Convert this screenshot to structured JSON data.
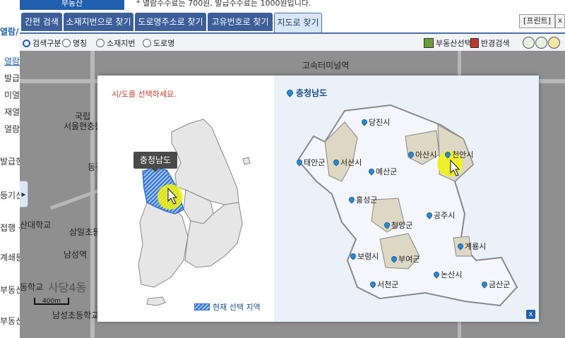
{
  "header": {
    "brand": "부동산",
    "note": "* 열람수수료는 700원, 발급수수료는 1000원입니다."
  },
  "left_strip": {
    "items": [
      "열람/",
      "열람",
      "발급",
      "미열",
      "재열",
      "열람",
      "발급현",
      "등기신",
      "접행 신",
      "계쇄등",
      "부동산",
      "부동산"
    ]
  },
  "tabs": [
    {
      "label": "간편 검색",
      "active": false
    },
    {
      "label": "소재지번으로 찾기",
      "active": false
    },
    {
      "label": "도로명주소로 찾기",
      "active": false
    },
    {
      "label": "고유번호로 찾기",
      "active": false
    },
    {
      "label": "지도로 찾기",
      "active": true
    }
  ],
  "toolbar": {
    "print_label": "[프린트]",
    "close_label": "x",
    "search_label": "검색구분 :",
    "radio_options": [
      "명칭",
      "소재지번",
      "도로명"
    ],
    "search_tool_label": "부동산선택",
    "road_view_label": "반경검색"
  },
  "map": {
    "labels": [
      "고속터미널역",
      "국립",
      "서울현충원",
      "동작",
      "산대학교",
      "삼일초등학",
      "남성역",
      "사당4동",
      "동학교",
      "남성초등학교"
    ],
    "scale": "400m"
  },
  "modal": {
    "instruction": "시/도를 선택하세요.",
    "selected_region": "충청남도",
    "tooltip": "충청남도",
    "legend": "현재 선택 지역",
    "close": "x",
    "cities": [
      "당진시",
      "태안군",
      "서산시",
      "아산시",
      "천안시",
      "예산군",
      "홍성군",
      "청양군",
      "공주시",
      "계룡시",
      "보령시",
      "부여군",
      "논산시",
      "서천군",
      "금산군"
    ]
  },
  "colors": {
    "tab_bg": "#3c5f99",
    "instruction": "#c0392b",
    "highlight": "#f3f311",
    "selected_hatch": "#2f6fd0"
  }
}
